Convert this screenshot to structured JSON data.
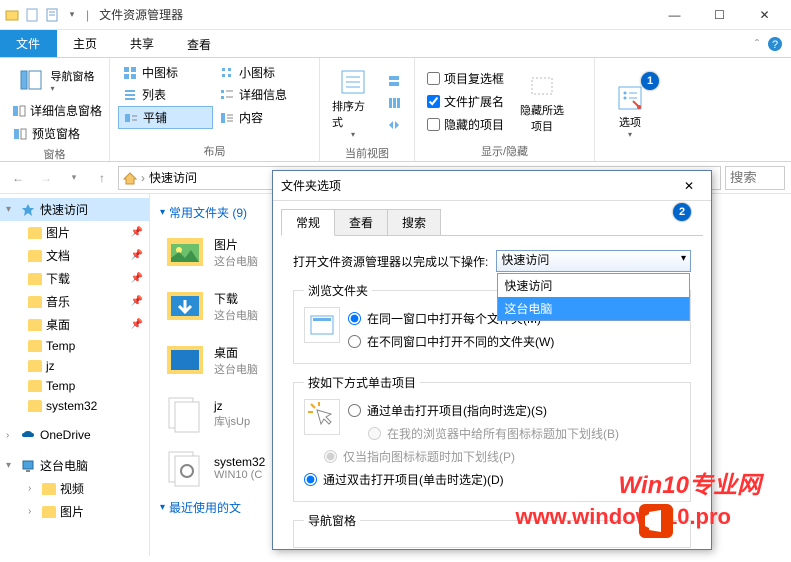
{
  "titlebar": {
    "title": "文件资源管理器"
  },
  "win": {
    "min": "—",
    "max": "☐",
    "close": "✕"
  },
  "tabs": {
    "file": "文件",
    "home": "主页",
    "share": "共享",
    "view": "查看"
  },
  "ribbon": {
    "pane_group": "窗格",
    "nav_pane": "导航窗格",
    "detail_pane": "详细信息窗格",
    "preview_pane": "预览窗格",
    "layout_group": "布局",
    "medium_icons": "中图标",
    "small_icons": "小图标",
    "list": "列表",
    "details": "详细信息",
    "tiles": "平铺",
    "content": "内容",
    "currentview_group": "当前视图",
    "sort_by": "排序方式",
    "showhide_group": "显示/隐藏",
    "item_checkboxes": "项目复选框",
    "file_ext": "文件扩展名",
    "hidden_items": "隐藏的项目",
    "hide_selected": "隐藏所选项目",
    "options": "选项"
  },
  "addr": {
    "current": "快速访问",
    "search_ph": "搜索"
  },
  "sidebar": {
    "quick_access": "快速访问",
    "items": [
      {
        "label": "图片"
      },
      {
        "label": "文档"
      },
      {
        "label": "下载"
      },
      {
        "label": "音乐"
      },
      {
        "label": "桌面"
      },
      {
        "label": "Temp"
      },
      {
        "label": "jz"
      },
      {
        "label": "Temp"
      },
      {
        "label": "system32"
      }
    ],
    "onedrive": "OneDrive",
    "this_pc": "这台电脑",
    "video": "视频",
    "pictures2": "图片"
  },
  "content": {
    "group1": "常用文件夹 (9)",
    "files": [
      {
        "name": "图片",
        "sub": "这台电脑"
      },
      {
        "name": "下载",
        "sub": "这台电脑"
      },
      {
        "name": "桌面",
        "sub": "这台电脑"
      },
      {
        "name": "jz",
        "sub": "库\\jsUp"
      },
      {
        "name": "system32",
        "sub": "WIN10 (C"
      }
    ],
    "group2": "最近使用的文"
  },
  "dialog": {
    "title": "文件夹选项",
    "tabs": {
      "general": "常规",
      "view": "查看",
      "search": "搜索"
    },
    "open_label": "打开文件资源管理器以完成以下操作:",
    "select_value": "快速访问",
    "opts": {
      "a": "快速访问",
      "b": "这台电脑"
    },
    "browse_legend": "浏览文件夹",
    "same_window": "在同一窗口中打开每个文件夹(M)",
    "diff_window": "在不同窗口中打开不同的文件夹(W)",
    "click_legend": "按如下方式单击项目",
    "single_click": "通过单击打开项目(指向时选定)(S)",
    "underline_browser": "在我的浏览器中给所有图标标题加下划线(B)",
    "underline_point": "仅当指向图标标题时加下划线(P)",
    "double_click": "通过双击打开项目(单击时选定)(D)",
    "nav_legend": "导航窗格"
  },
  "watermark": {
    "line1": "Win10专业网",
    "line2": "www.windows10.pro"
  }
}
